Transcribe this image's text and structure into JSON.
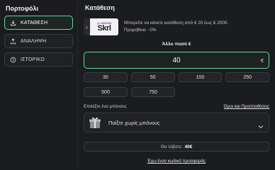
{
  "sidebar": {
    "title": "Πορτοφόλι",
    "items": [
      {
        "label": "ΚΑΤΑΘΕΣΗ",
        "icon": "deposit-icon",
        "active": true
      },
      {
        "label": "ΑΝΑΛΗΨΗ",
        "icon": "withdraw-icon",
        "active": false
      },
      {
        "label": "ΙΣΤΟΡΙΚΟ",
        "icon": "history-icon",
        "active": false
      }
    ]
  },
  "main": {
    "title": "Κατάθεση",
    "provider": {
      "logo_top": "@ UNIONS",
      "logo_brand": "Skrl",
      "line1": "Μπορείτε να κάνετε κατάθεση από € 20 έως € 2000.",
      "line2": "Προμήθεια - 0%"
    },
    "amount_label": "Άλλο ποσό €",
    "amount_value": "40",
    "currency_symbol": "€",
    "quick_amounts_row1": [
      "30",
      "50",
      "100",
      "250"
    ],
    "quick_amounts_row2": [
      "500",
      "750"
    ],
    "bonus_label": "Επιλέξτε ένα μπόνους",
    "terms_link": "Όροι και Προϋποθέσεις",
    "bonus_selected": "Παίξτε χωρίς μπόνους",
    "receive_label": "Θα λάβετε:",
    "receive_amount": "40€",
    "promo_link": "Έχω έναν κωδικό προσφοράς"
  },
  "colors": {
    "accent": "#5fd9a2",
    "background": "#1b1c1f",
    "border": "#3a3b40"
  }
}
